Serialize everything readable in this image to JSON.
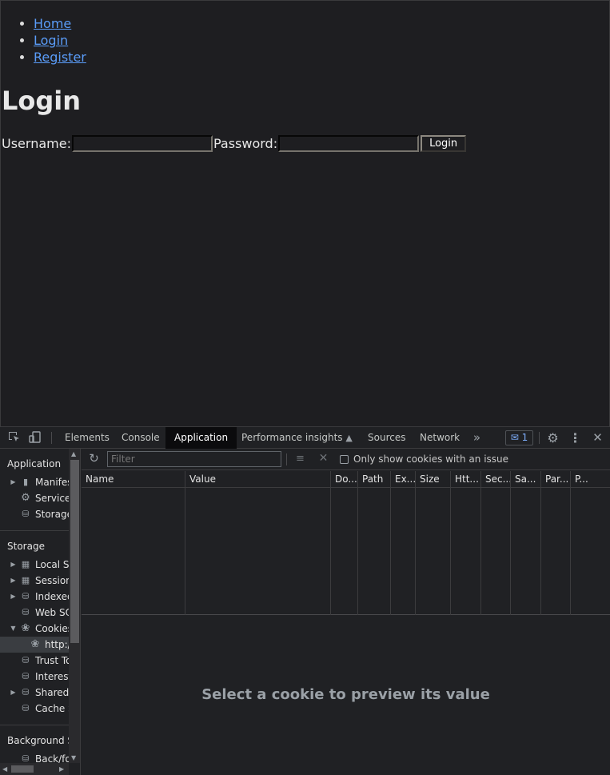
{
  "page": {
    "nav": [
      {
        "label": "Home"
      },
      {
        "label": "Login"
      },
      {
        "label": "Register"
      }
    ],
    "heading": "Login",
    "form": {
      "username_label": "Username:",
      "password_label": "Password:",
      "submit_label": "Login"
    }
  },
  "devtools": {
    "tabs": [
      {
        "label": "Elements"
      },
      {
        "label": "Console"
      },
      {
        "label": "Application",
        "active": true
      },
      {
        "label": "Performance insights"
      },
      {
        "label": "Sources"
      },
      {
        "label": "Network"
      }
    ],
    "issues_count": "1",
    "sidebar": {
      "application_header": "Application",
      "application_items": [
        {
          "label": "Manifest",
          "icon": "file-icon"
        },
        {
          "label": "Service workers",
          "icon": "gear-icon"
        },
        {
          "label": "Storage",
          "icon": "database-icon"
        }
      ],
      "storage_header": "Storage",
      "storage_items": [
        {
          "label": "Local Storage",
          "icon": "grid-icon"
        },
        {
          "label": "Session Storage",
          "icon": "grid-icon"
        },
        {
          "label": "IndexedDB",
          "icon": "database-icon"
        },
        {
          "label": "Web SQL",
          "icon": "database-icon"
        },
        {
          "label": "Cookies",
          "icon": "cookie-icon"
        },
        {
          "label": "http://",
          "icon": "cookie-icon"
        },
        {
          "label": "Trust Tokens",
          "icon": "database-icon"
        },
        {
          "label": "Interest groups",
          "icon": "database-icon"
        },
        {
          "label": "Shared storage",
          "icon": "database-icon"
        },
        {
          "label": "Cache Storage",
          "icon": "database-icon"
        }
      ],
      "background_header": "Background Services",
      "background_items": [
        {
          "label": "Back/forward cache",
          "icon": "database-icon"
        }
      ]
    },
    "toolbar": {
      "filter_placeholder": "Filter",
      "only_issues_label": "Only show cookies with an issue"
    },
    "columns": [
      "Name",
      "Value",
      "Do...",
      "Path",
      "Ex...",
      "Size",
      "Htt...",
      "Sec...",
      "Sa...",
      "Par...",
      "P..."
    ],
    "preview_message": "Select a cookie to preview its value"
  }
}
